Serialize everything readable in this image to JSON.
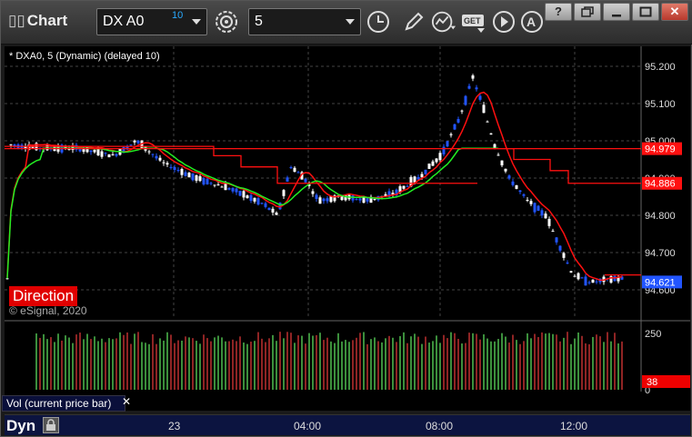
{
  "toolbar": {
    "title": "Chart",
    "symbol": "DX A0",
    "symbol_superscript": "10",
    "interval": "5",
    "icons": [
      "settings-gear-icon",
      "clock-icon",
      "pencil-icon",
      "study-icon",
      "get-icon",
      "play-icon",
      "alert-icon"
    ]
  },
  "window_buttons": {
    "help": "?",
    "restore_label": "",
    "minimize_label": "",
    "maximize_label": "",
    "close": "✕"
  },
  "chart": {
    "legend": "* DXA0, 5 (Dynamic) (delayed 10)",
    "direction_label": "Direction",
    "copyright": "© eSignal, 2020",
    "colors": {
      "background": "#000000",
      "bull_candle": "#ffffff",
      "bear_candle": "#2255ff",
      "ma_red": "#ff1010",
      "ma_green": "#22ee22",
      "grid": "#444444"
    },
    "price_axis": [
      "95.200",
      "95.100",
      "95.000",
      "94.900",
      "94.800",
      "94.700",
      "94.600"
    ],
    "price_tags": [
      {
        "value": "94.979",
        "color": "#ff1010"
      },
      {
        "value": "94.886",
        "color": "#ff1010"
      },
      {
        "value": "94.621",
        "color": "#2255ff"
      }
    ]
  },
  "volume": {
    "label": "Vol (current price bar)",
    "axis": [
      "250",
      "0"
    ],
    "current_tag": "38",
    "close_label": "✕"
  },
  "bottom": {
    "mode": "Dyn",
    "time_labels": [
      "23",
      "04:00",
      "08:00",
      "12:00"
    ]
  }
}
